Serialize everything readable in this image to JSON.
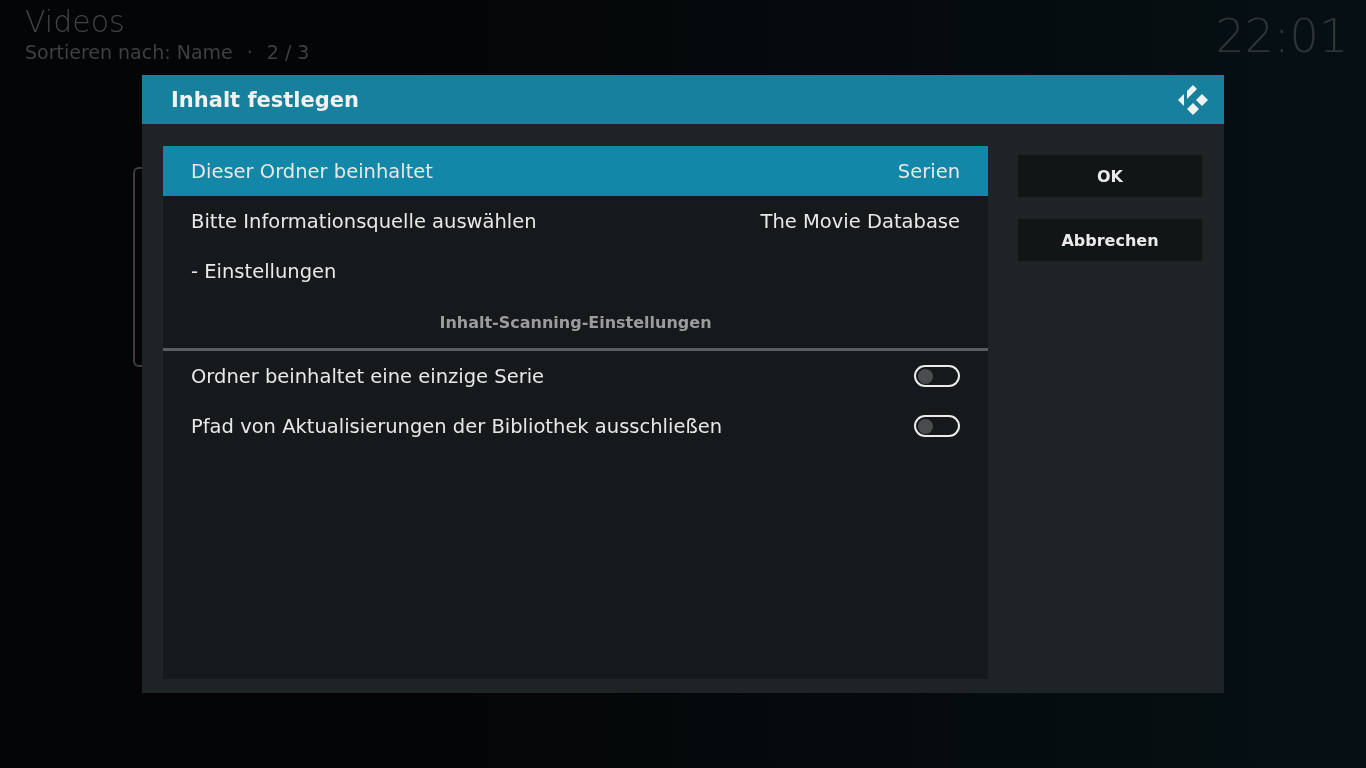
{
  "header": {
    "title": "Videos",
    "subtitle": "Sortieren nach: Name",
    "separator": "·",
    "page": "2 / 3",
    "clock": "22:01"
  },
  "dialog": {
    "title": "Inhalt festlegen",
    "items": [
      {
        "kind": "value",
        "label": "Dieser Ordner beinhaltet",
        "value": "Serien",
        "selected": true
      },
      {
        "kind": "value",
        "label": "Bitte Informationsquelle auswählen",
        "value": "The Movie Database",
        "selected": false
      },
      {
        "kind": "value",
        "label": "- Einstellungen",
        "selected": false
      },
      {
        "kind": "section",
        "label": "Inhalt-Scanning-Einstellungen"
      },
      {
        "kind": "toggle",
        "label": "Ordner beinhaltet eine einzige Serie",
        "on": false,
        "selected": false
      },
      {
        "kind": "toggle",
        "label": "Pfad von Aktualisierungen der Bibliothek ausschließen",
        "on": false,
        "selected": false
      }
    ],
    "buttons": [
      "OK",
      "Abbrechen"
    ]
  }
}
